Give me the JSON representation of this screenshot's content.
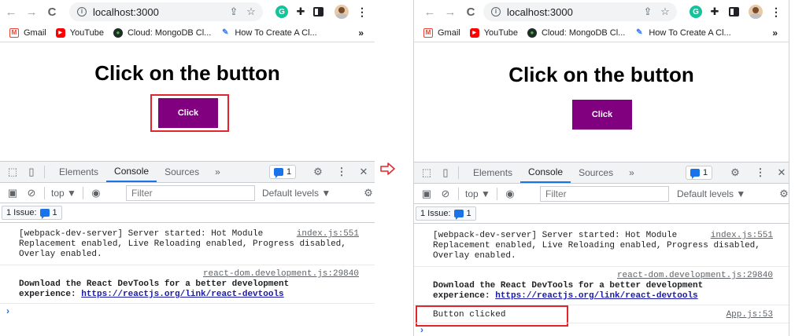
{
  "browser": {
    "url": "localhost:3000",
    "bookmarks": [
      {
        "label": "Gmail",
        "icon": "gmail-icon"
      },
      {
        "label": "YouTube",
        "icon": "youtube-icon"
      },
      {
        "label": "Cloud: MongoDB Cl...",
        "icon": "mongodb-icon"
      },
      {
        "label": "How To Create A Cl...",
        "icon": "page-icon"
      }
    ],
    "more": "»"
  },
  "page": {
    "title": "Click on the button",
    "button_label": "Click"
  },
  "devtools": {
    "tabs": [
      "Elements",
      "Console",
      "Sources"
    ],
    "more_tabs": "»",
    "issues_badge": "1",
    "context": "top ▼",
    "filter_placeholder": "Filter",
    "levels": "Default levels ▼",
    "issue_label": "1 Issue:",
    "issue_count": "1",
    "messages": [
      {
        "source": "index.js:551",
        "lines": [
          "[webpack-dev-server] Server started: Hot Module",
          "Replacement enabled, Live Reloading enabled, Progress disabled,",
          "Overlay enabled."
        ]
      },
      {
        "source": "react-dom.development.js:29840",
        "lines": [
          "Download the React DevTools for a better development",
          "experience: "
        ],
        "link": "https://reactjs.org/link/react-devtools"
      }
    ],
    "new_message": {
      "text": "Button clicked",
      "source": "App.js:53"
    },
    "prompt": "›"
  },
  "colors": {
    "button_bg": "#800080",
    "highlight": "#e0262c",
    "accent": "#1a73e8"
  }
}
